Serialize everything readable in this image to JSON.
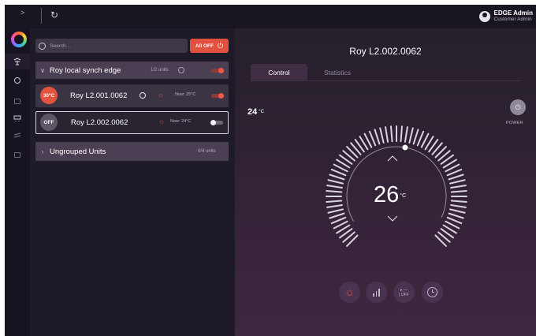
{
  "topbar": {
    "sidebar_toggle": ">",
    "refresh_icon": "refresh-icon",
    "user": {
      "name": "EDGE Admin",
      "role": "Customer Admin"
    }
  },
  "search": {
    "placeholder": "Search..."
  },
  "all_off": {
    "label": "All OFF"
  },
  "groups": [
    {
      "name": "Roy local synch edge",
      "units_count": "1/2 units",
      "expanded": true,
      "toggle_on": true,
      "units": [
        {
          "name": "Roy L2.001.0062",
          "badge": "30°C",
          "now": "Now: 25°C",
          "on": true
        },
        {
          "name": "Roy L2.002.0062",
          "badge": "OFF",
          "now": "Now: 24°C",
          "on": false,
          "selected": true
        }
      ]
    },
    {
      "name": "Ungrouped Units",
      "units_count": "0/4 units",
      "expanded": false
    }
  ],
  "detail": {
    "title": "Roy L2.002.0062",
    "tabs": [
      {
        "label": "Control",
        "active": true
      },
      {
        "label": "Statistics",
        "active": false
      }
    ],
    "current_temp": "24",
    "current_temp_unit": "°C",
    "setpoint": "26",
    "setpoint_unit": "°C",
    "power_label": "POWER",
    "fan_label": "OFF",
    "modes": [
      "sun-icon",
      "fan-speed-icon",
      "swing-icon",
      "clock-icon"
    ]
  },
  "colors": {
    "accent": "#e2503f",
    "bg_dark": "#1d1826",
    "group_bg": "#4b3f54"
  }
}
